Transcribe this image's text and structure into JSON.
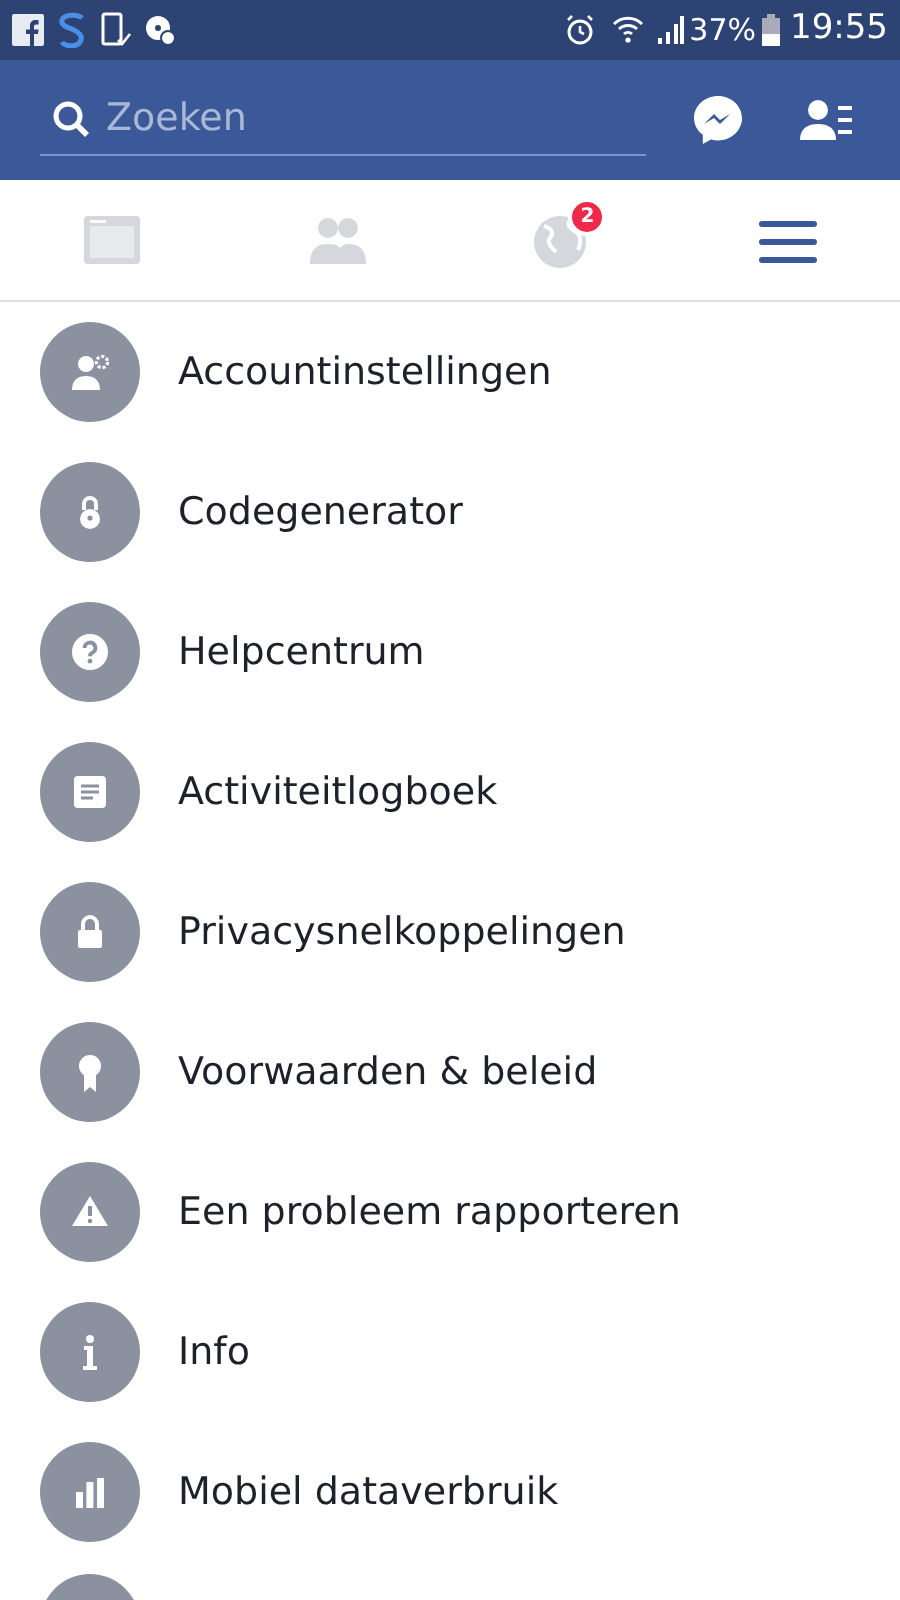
{
  "status_bar": {
    "battery_percent": "37%",
    "time": "19:55"
  },
  "header": {
    "search": {
      "placeholder": "Zoeken"
    }
  },
  "tabs": [
    {
      "kind": "feed",
      "selected": false
    },
    {
      "kind": "friends",
      "selected": false
    },
    {
      "kind": "globe",
      "selected": false,
      "badge": "2"
    },
    {
      "kind": "menu",
      "selected": true
    }
  ],
  "menu_items": [
    {
      "kind": "account",
      "label": "Accountinstellingen"
    },
    {
      "kind": "padlock",
      "label": "Codegenerator"
    },
    {
      "kind": "help",
      "label": "Helpcentrum"
    },
    {
      "kind": "log",
      "label": "Activiteitlogboek"
    },
    {
      "kind": "privacy",
      "label": "Privacysnelkoppelingen"
    },
    {
      "kind": "terms",
      "label": "Voorwaarden & beleid"
    },
    {
      "kind": "report",
      "label": "Een probleem rapporteren"
    },
    {
      "kind": "info",
      "label": "Info"
    },
    {
      "kind": "data",
      "label": "Mobiel dataverbruik"
    },
    {
      "kind": "partial"
    }
  ]
}
